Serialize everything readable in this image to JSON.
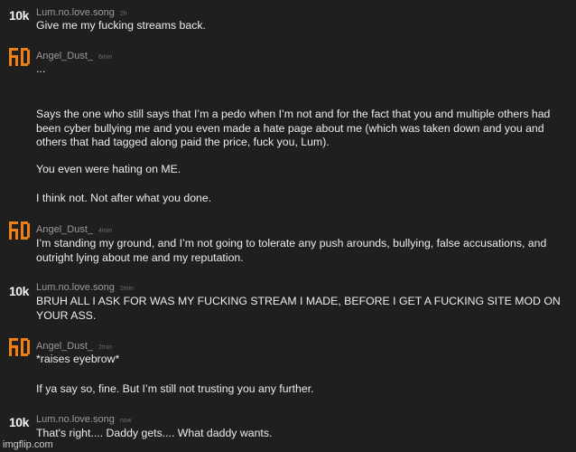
{
  "comments": [
    {
      "username": "Lum.no.love.song",
      "time": "2h",
      "avatar_text": "10k",
      "lines": [
        "Give me my fucking streams back."
      ]
    },
    {
      "username": "Angel_Dust_",
      "time": "6min",
      "lines": [
        "...",
        "Says the one who still says that I’m a pedo when I’m not and for the fact that you and multiple others had been cyber bullying me and you even made a hate page about me (which was taken down and you and others that had tagged along paid the price, fuck you, Lum).",
        "You even were hating on ME.",
        "I think not. Not after what you done."
      ]
    },
    {
      "username": "Angel_Dust_",
      "time": "4min",
      "lines": [
        "I’m standing my ground, and I’m not going to tolerate any push arounds, bullying, false accusations, and outright lying about me and my reputation."
      ]
    },
    {
      "username": "Lum.no.love.song",
      "time": "2min",
      "avatar_text": "10k",
      "lines": [
        "BRUH ALL I ASK FOR WAS MY FUCKING STREAM I MADE, BEFORE I GET A FUCKING SITE MOD ON YOUR ASS."
      ]
    },
    {
      "username": "Angel_Dust_",
      "time": "2min",
      "lines": [
        "*raises eyebrow*",
        "If ya say so, fine. But I’m still not trusting you any further."
      ]
    },
    {
      "username": "Lum.no.love.song",
      "time": "now",
      "avatar_text": "10k",
      "lines": [
        "That's right.... Daddy gets.... What daddy wants."
      ]
    }
  ],
  "watermark": "imgflip.com",
  "colors": {
    "background": "#1f1f1f",
    "avatar_orange": "#f07f14",
    "username": "#9b9b9b",
    "body_text": "#ececec"
  }
}
